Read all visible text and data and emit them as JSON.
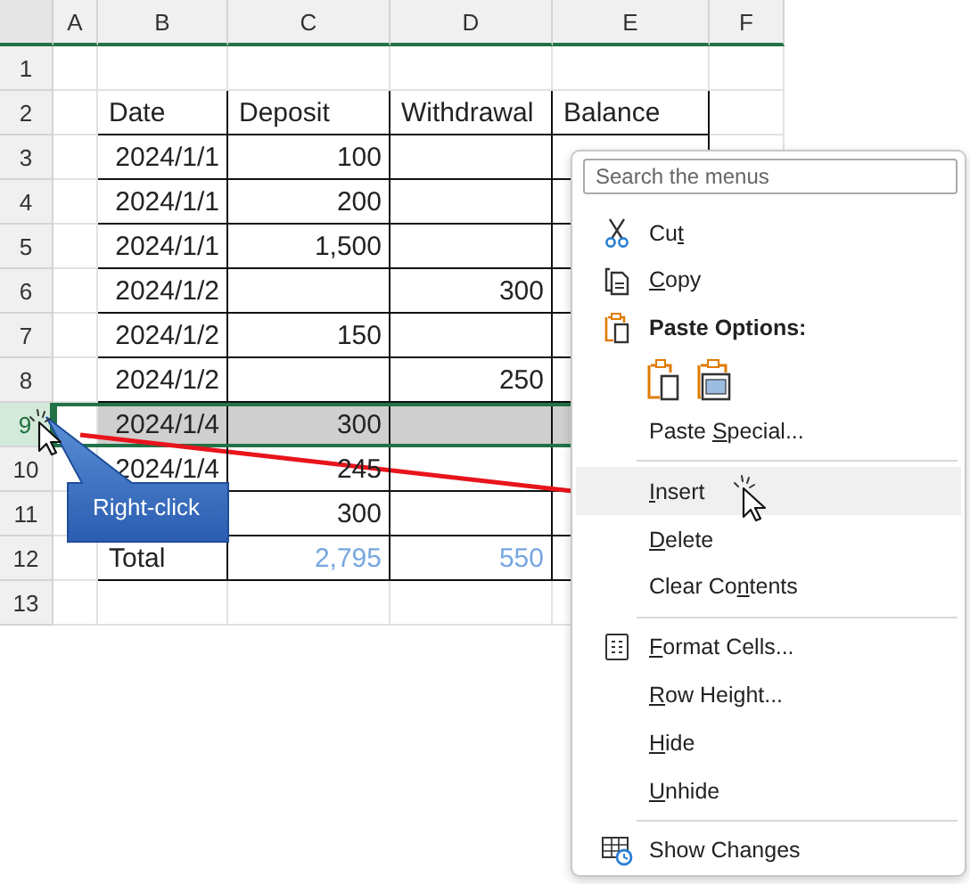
{
  "sheet": {
    "columns": [
      "A",
      "B",
      "C",
      "D",
      "E",
      "F"
    ],
    "rows": [
      {
        "label": "1",
        "selected": false,
        "kind": "blank",
        "cells": []
      },
      {
        "label": "2",
        "selected": false,
        "kind": "header",
        "cells": [
          "",
          "Date",
          "Deposit",
          "Withdrawal",
          "Balance"
        ]
      },
      {
        "label": "3",
        "selected": false,
        "kind": "data",
        "cells": [
          "",
          "2024/1/1",
          "100",
          "",
          ""
        ]
      },
      {
        "label": "4",
        "selected": false,
        "kind": "data",
        "cells": [
          "",
          "2024/1/1",
          "200",
          "",
          ""
        ]
      },
      {
        "label": "5",
        "selected": false,
        "kind": "data",
        "cells": [
          "",
          "2024/1/1",
          "1,500",
          "",
          ""
        ]
      },
      {
        "label": "6",
        "selected": false,
        "kind": "data",
        "cells": [
          "",
          "2024/1/2",
          "",
          "300",
          ""
        ]
      },
      {
        "label": "7",
        "selected": false,
        "kind": "data",
        "cells": [
          "",
          "2024/1/2",
          "150",
          "",
          ""
        ]
      },
      {
        "label": "8",
        "selected": false,
        "kind": "data",
        "cells": [
          "",
          "2024/1/2",
          "",
          "250",
          ""
        ]
      },
      {
        "label": "9",
        "selected": true,
        "kind": "data",
        "cells": [
          "",
          "2024/1/4",
          "300",
          "",
          ""
        ]
      },
      {
        "label": "10",
        "selected": false,
        "kind": "data",
        "cells": [
          "",
          "2024/1/4",
          "245",
          "",
          ""
        ]
      },
      {
        "label": "11",
        "selected": false,
        "kind": "data",
        "cells": [
          "",
          "",
          "300",
          "",
          ""
        ]
      },
      {
        "label": "12",
        "selected": false,
        "kind": "total",
        "cells": [
          "",
          "Total",
          "2,795",
          "550",
          ""
        ]
      },
      {
        "label": "13",
        "selected": false,
        "kind": "blank",
        "cells": []
      }
    ]
  },
  "callout": {
    "text": "Right-click"
  },
  "context_menu": {
    "search": {
      "placeholder": "Search the menus"
    },
    "items": [
      {
        "kind": "scissors",
        "before": "Cu",
        "access_key": "t",
        "selected": false
      },
      {
        "kind": "copy",
        "access_key": "C",
        "after": "opy",
        "selected": false
      },
      {
        "kind": "heading",
        "after": "Paste Options:"
      },
      {
        "kind": "paste-buttons"
      },
      {
        "kind": "plain",
        "before": "Paste ",
        "access_key": "S",
        "after": "pecial...",
        "selected": false
      },
      {
        "kind": "separator"
      },
      {
        "kind": "plain",
        "access_key": "I",
        "after": "nsert",
        "selected": true
      },
      {
        "kind": "plain",
        "access_key": "D",
        "after": "elete",
        "selected": false
      },
      {
        "kind": "plain",
        "before": "Clear Co",
        "access_key": "n",
        "after": "tents",
        "selected": false
      },
      {
        "kind": "separator"
      },
      {
        "kind": "format",
        "access_key": "F",
        "after": "ormat Cells...",
        "selected": false
      },
      {
        "kind": "plain",
        "access_key": "R",
        "after": "ow Height...",
        "selected": false
      },
      {
        "kind": "plain",
        "access_key": "H",
        "after": "ide",
        "selected": false
      },
      {
        "kind": "plain",
        "access_key": "U",
        "after": "nhide",
        "selected": false
      },
      {
        "kind": "separator"
      },
      {
        "kind": "changes",
        "after": "Show Changes",
        "selected": false
      }
    ]
  }
}
